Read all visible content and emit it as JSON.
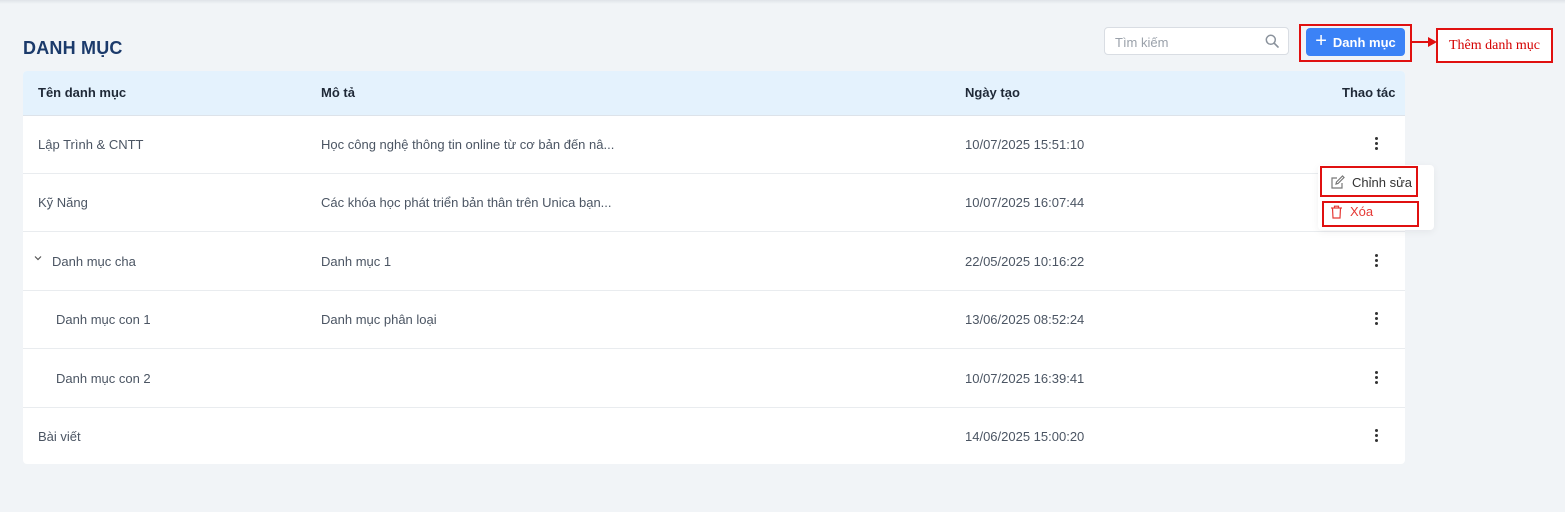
{
  "page": {
    "title": "DANH MỤC"
  },
  "search": {
    "placeholder": "Tìm kiếm",
    "value": ""
  },
  "toolbar": {
    "add_label": "Danh mục",
    "add_annotation": "Thêm danh mục"
  },
  "table": {
    "columns": [
      "Tên danh mục",
      "Mô tả",
      "Ngày tạo",
      "Thao tác"
    ],
    "rows": [
      {
        "name": "Lập Trình & CNTT",
        "desc": "Học công nghệ thông tin online từ cơ bản đến nâ...",
        "date": "10/07/2025 15:51:10"
      },
      {
        "name": "Kỹ Năng",
        "desc": "Các khóa học phát triển bản thân trên Unica bạn...",
        "date": "10/07/2025 16:07:44"
      },
      {
        "name": "Danh mục cha",
        "desc": "Danh mục 1",
        "date": "22/05/2025 10:16:22"
      },
      {
        "name": "Danh mục con 1",
        "desc": "Danh mục phân loại",
        "date": "13/06/2025 08:52:24"
      },
      {
        "name": "Danh mục con 2",
        "desc": "",
        "date": "10/07/2025 16:39:41"
      },
      {
        "name": "Bài viết",
        "desc": "",
        "date": "14/06/2025 15:00:20"
      }
    ]
  },
  "row_menu": {
    "edit_label": "Chỉnh sửa",
    "delete_label": "Xóa"
  },
  "colors": {
    "primary": "#3b82f6",
    "header_bg": "#e4f2fd",
    "annotation": "#e01010",
    "danger": "#e53935"
  }
}
